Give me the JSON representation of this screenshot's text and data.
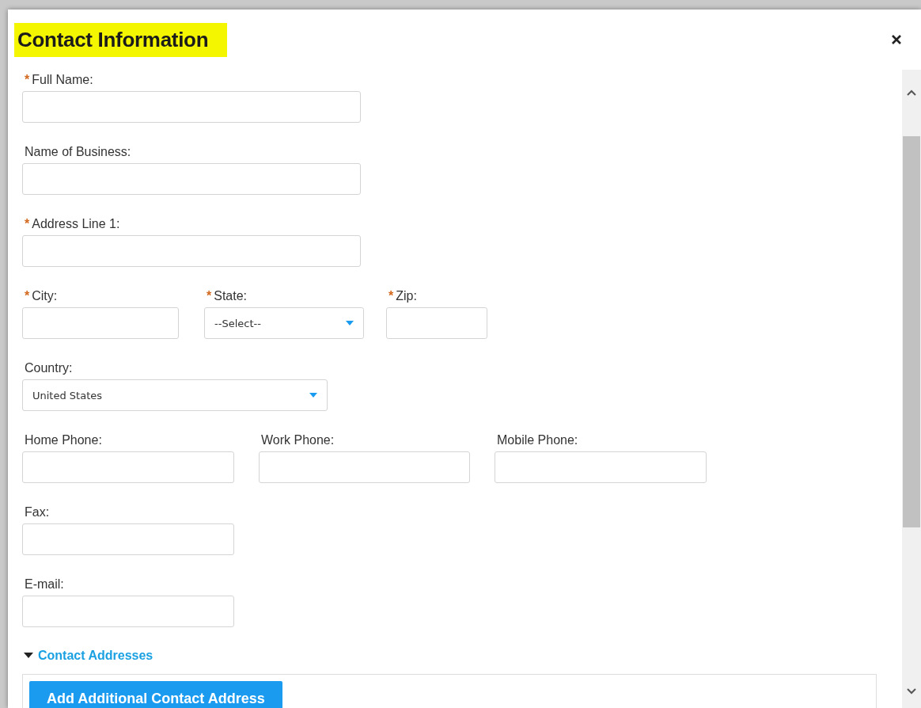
{
  "dialog": {
    "title": "Contact Information"
  },
  "required_mark": "*",
  "rows": [
    {
      "fields": [
        {
          "kind": "text",
          "label": "Full Name:",
          "required": true
        }
      ]
    },
    {
      "fields": [
        {
          "kind": "text",
          "label": "Name of Business:",
          "required": false
        }
      ]
    },
    {
      "fields": [
        {
          "kind": "text",
          "label": "Address Line 1:",
          "required": true
        }
      ]
    },
    {
      "fields": [
        {
          "kind": "text",
          "label": "City:",
          "required": true
        },
        {
          "kind": "select",
          "label": "State:",
          "required": true,
          "value": "--Select--"
        },
        {
          "kind": "text",
          "label": "Zip:",
          "required": true
        }
      ]
    },
    {
      "fields": [
        {
          "kind": "select",
          "label": "Country:",
          "required": false,
          "value": "United States"
        }
      ]
    },
    {
      "fields": [
        {
          "kind": "text",
          "label": "Home Phone:",
          "required": false
        },
        {
          "kind": "text",
          "label": "Work Phone:",
          "required": false
        },
        {
          "kind": "text",
          "label": "Mobile Phone:",
          "required": false
        }
      ]
    },
    {
      "fields": [
        {
          "kind": "text",
          "label": "Fax:",
          "required": false
        }
      ]
    },
    {
      "fields": [
        {
          "kind": "text",
          "label": "E-mail:",
          "required": false
        }
      ]
    }
  ],
  "section": {
    "label": "Contact Addresses",
    "expanded": true,
    "button": "Add Additional Contact Address"
  }
}
